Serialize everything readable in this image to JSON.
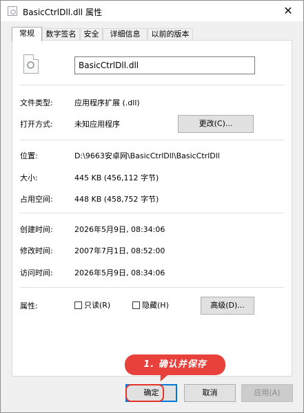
{
  "window": {
    "title": "BasicCtrlDll.dll 属性",
    "close_glyph": "✕"
  },
  "tabs": [
    {
      "label": "常规",
      "active": true
    },
    {
      "label": "数字签名"
    },
    {
      "label": "安全"
    },
    {
      "label": "详细信息"
    },
    {
      "label": "以前的版本"
    }
  ],
  "general": {
    "file_name": "BasicCtrlDll.dll",
    "file_type_label": "文件类型:",
    "file_type_value": "应用程序扩展 (.dll)",
    "opens_with_label": "打开方式:",
    "opens_with_value": "未知应用程序",
    "change_button": "更改(C)...",
    "location_label": "位置:",
    "location_value": "D:\\9663安卓网\\BasicCtrlDll\\BasicCtrlDll",
    "size_label": "大小:",
    "size_value": "445 KB (456,112 字节)",
    "size_on_disk_label": "占用空间:",
    "size_on_disk_value": "448 KB (458,752 字节)",
    "created_label": "创建时间:",
    "created_value": "2026年5月9日, 08:34:06",
    "modified_label": "修改时间:",
    "modified_value": "2007年7月1日, 08:52:00",
    "accessed_label": "访问时间:",
    "accessed_value": "2026年5月9日, 08:34:06",
    "attributes_label": "属性:",
    "readonly_label": "只读(R)",
    "hidden_label": "隐藏(H)",
    "advanced_button": "高级(D)..."
  },
  "footer": {
    "ok": "确定",
    "cancel": "取消",
    "apply": "应用(A)"
  },
  "annotation": {
    "callout_text": "1. 确认并保存"
  },
  "colors": {
    "accent": "#0078d7",
    "annotation_red": "#e8413b"
  }
}
